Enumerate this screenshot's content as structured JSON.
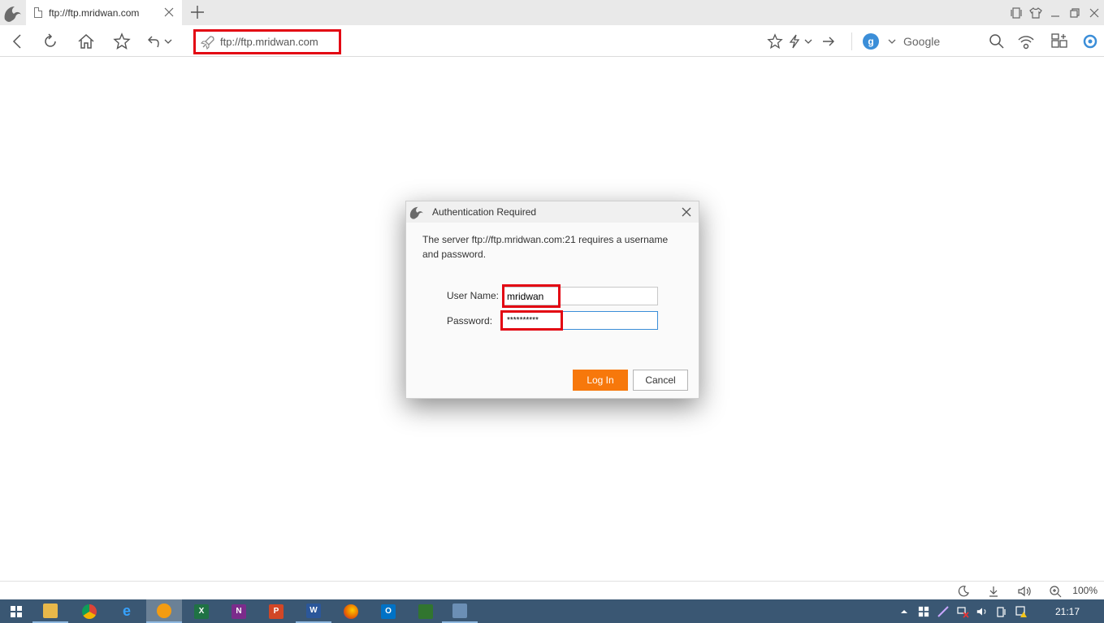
{
  "tab": {
    "title": "ftp://ftp.mridwan.com"
  },
  "address": {
    "url": "ftp://ftp.mridwan.com"
  },
  "search": {
    "engine_letter": "g",
    "engine_name": "Google"
  },
  "dialog": {
    "title": "Authentication Required",
    "message": "The server ftp://ftp.mridwan.com:21 requires a username and password.",
    "username_label": "User Name:",
    "username_value": "mridwan",
    "password_label": "Password:",
    "password_value": "**********",
    "login_label": "Log In",
    "cancel_label": "Cancel"
  },
  "status": {
    "zoom": "100%"
  },
  "taskbar": {
    "apps": [
      {
        "name": "file-explorer",
        "letter": "",
        "color": "#e8b84a"
      },
      {
        "name": "chrome",
        "letter": "",
        "color": "#4caf50"
      },
      {
        "name": "internet-explorer",
        "letter": "e",
        "color": "#1e90ff"
      },
      {
        "name": "uc-browser",
        "letter": "",
        "color": "#f39c12"
      },
      {
        "name": "excel",
        "letter": "X",
        "color": "#1f7244"
      },
      {
        "name": "onenote",
        "letter": "N",
        "color": "#7b2c8b"
      },
      {
        "name": "powerpoint",
        "letter": "P",
        "color": "#d24726"
      },
      {
        "name": "word",
        "letter": "W",
        "color": "#2b579a"
      },
      {
        "name": "firefox",
        "letter": "",
        "color": "#e66000"
      },
      {
        "name": "outlook",
        "letter": "O",
        "color": "#0072c6"
      },
      {
        "name": "project",
        "letter": "",
        "color": "#31752f"
      },
      {
        "name": "virtualbox",
        "letter": "",
        "color": "#6b8fb5"
      }
    ],
    "clock": "21:17"
  },
  "colors": {
    "highlight": "#e30613",
    "accent": "#f7780b",
    "taskbar": "#3a5773"
  }
}
